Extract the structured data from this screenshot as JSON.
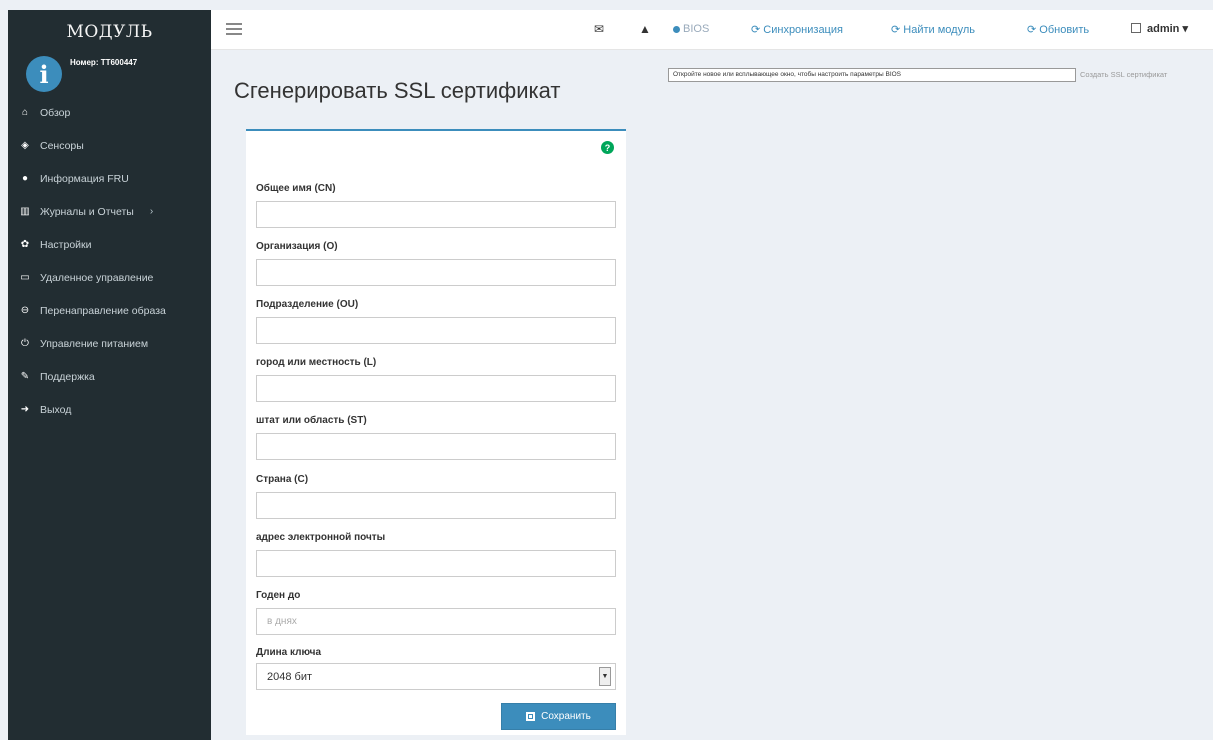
{
  "sidebar": {
    "brand": "МОДУЛЬ",
    "user_icon_glyph": "i",
    "user_number": "Номер: TT600447",
    "items": [
      {
        "label": "Обзор",
        "icon": "home-icon"
      },
      {
        "label": "Сенсоры",
        "icon": "sensors-icon"
      },
      {
        "label": "Информация FRU",
        "icon": "info-icon"
      },
      {
        "label": "Журналы и Отчеты",
        "icon": "chart-icon",
        "caret": "›"
      },
      {
        "label": "Настройки",
        "icon": "gear-icon"
      },
      {
        "label": "Удаленное управление",
        "icon": "monitor-icon"
      },
      {
        "label": "Перенаправление образа",
        "icon": "disk-icon"
      },
      {
        "label": "Управление питанием",
        "icon": "power-icon"
      },
      {
        "label": "Поддержка",
        "icon": "wrench-icon"
      },
      {
        "label": "Выход",
        "icon": "logout-icon"
      }
    ]
  },
  "topbar": {
    "nav": {
      "bios": "BIOS",
      "sync": "Синхронизация",
      "find_module": "Найти модуль",
      "refresh": "Обновить"
    },
    "user": "admin ▾"
  },
  "tooltip": "Откройте новое или всплывающее окно, чтобы настроить параметры BIOS",
  "breadcrumb": "Создать SSL сертификат",
  "page": {
    "title": "Сгенерировать SSL сертификат"
  },
  "form": {
    "fields": [
      {
        "label": "Общее имя (CN)",
        "value": "",
        "placeholder": ""
      },
      {
        "label": "Организация (O)",
        "value": "",
        "placeholder": ""
      },
      {
        "label": "Подразделение (OU)",
        "value": "",
        "placeholder": ""
      },
      {
        "label": "город или местность (L)",
        "value": "",
        "placeholder": ""
      },
      {
        "label": "штат или область (ST)",
        "value": "",
        "placeholder": ""
      },
      {
        "label": "Страна (C)",
        "value": "",
        "placeholder": ""
      },
      {
        "label": "адрес электронной почты",
        "value": "",
        "placeholder": ""
      },
      {
        "label": "Годен до",
        "value": "",
        "placeholder": "в днях"
      }
    ],
    "key_length_label": "Длина ключа",
    "key_length_value": "2048 бит",
    "help_glyph": "?",
    "save_label": "Сохранить"
  },
  "colors": {
    "accent": "#3c8dbc",
    "sidebar_bg": "#222d32",
    "help": "#00a65a"
  }
}
